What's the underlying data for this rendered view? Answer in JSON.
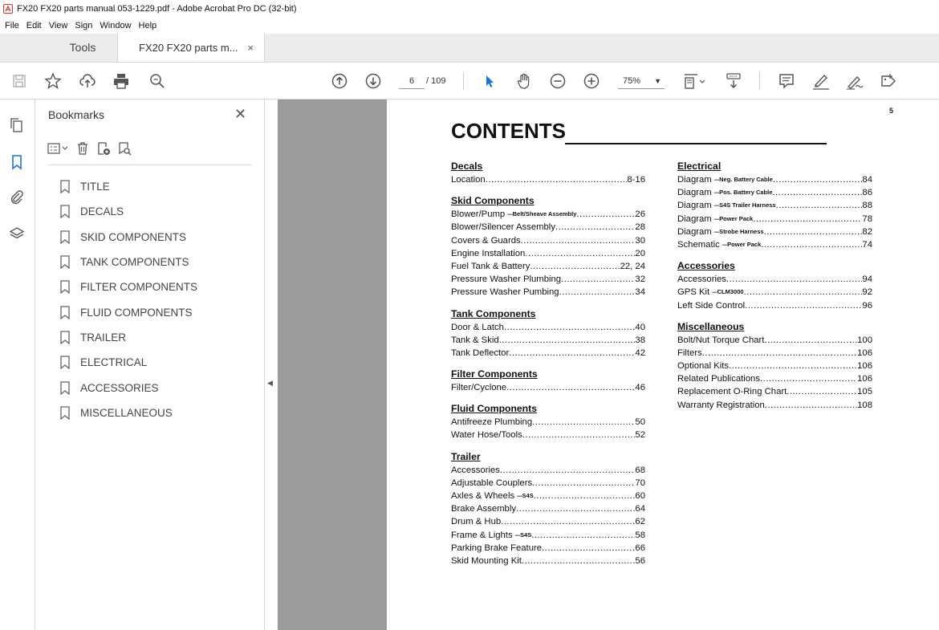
{
  "window": {
    "title": "FX20 FX20 parts manual 053-1229.pdf - Adobe Acrobat Pro DC (32-bit)"
  },
  "menu": [
    "File",
    "Edit",
    "View",
    "Sign",
    "Window",
    "Help"
  ],
  "tabs": {
    "tools": "Tools",
    "document": "FX20 FX20 parts m...",
    "close": "×"
  },
  "toolbar": {
    "page_current": "6",
    "page_total": "/ 109",
    "zoom": "75%"
  },
  "sidebar": {
    "title": "Bookmarks",
    "close": "✕",
    "items": [
      "TITLE",
      "DECALS",
      "SKID COMPONENTS",
      "TANK COMPONENTS",
      "FILTER COMPONENTS",
      "FLUID COMPONENTS",
      "TRAILER",
      "ELECTRICAL",
      "ACCESSORIES",
      "MISCELLANEOUS"
    ]
  },
  "page": {
    "number": "5",
    "title": "CONTENTS",
    "columns": [
      [
        {
          "heading": "Decals",
          "entries": [
            {
              "label": "Location",
              "sub": "",
              "page": "8-16"
            }
          ]
        },
        {
          "heading": "Skid Components",
          "entries": [
            {
              "label": "Blower/Pump – ",
              "sub": "Belt/Sheave Assembly",
              "page": "26"
            },
            {
              "label": "Blower/Silencer Assembly",
              "sub": "",
              "page": "28"
            },
            {
              "label": "Covers & Guards",
              "sub": "",
              "page": "30"
            },
            {
              "label": "Engine Installation",
              "sub": "",
              "page": "20"
            },
            {
              "label": "Fuel Tank & Battery",
              "sub": "",
              "page": "22, 24"
            },
            {
              "label": "Pressure Washer Plumbing",
              "sub": "",
              "page": "32"
            },
            {
              "label": "Pressure Washer Pumbing",
              "sub": "",
              "page": "34"
            }
          ]
        },
        {
          "heading": "Tank Components",
          "entries": [
            {
              "label": "Door & Latch",
              "sub": "",
              "page": "40"
            },
            {
              "label": "Tank & Skid",
              "sub": "",
              "page": "38"
            },
            {
              "label": "Tank Deflector",
              "sub": "",
              "page": "42"
            }
          ]
        },
        {
          "heading": "Filter Components",
          "entries": [
            {
              "label": "Filter/Cyclone",
              "sub": "",
              "page": "46"
            }
          ]
        },
        {
          "heading": "Fluid Components",
          "entries": [
            {
              "label": "Antifreeze Plumbing",
              "sub": "",
              "page": "50"
            },
            {
              "label": "Water Hose/Tools",
              "sub": "",
              "page": "52"
            }
          ]
        },
        {
          "heading": "Trailer",
          "entries": [
            {
              "label": "Accessories",
              "sub": "",
              "page": "68"
            },
            {
              "label": "Adjustable Couplers",
              "sub": "",
              "page": "70"
            },
            {
              "label": "Axles & Wheels – ",
              "sub": "S4S",
              "page": "60"
            },
            {
              "label": "Brake Assembly",
              "sub": "",
              "page": "64"
            },
            {
              "label": "Drum & Hub",
              "sub": "",
              "page": "62"
            },
            {
              "label": "Frame & Lights – ",
              "sub": "S4S",
              "page": "58"
            },
            {
              "label": "Parking Brake Feature",
              "sub": "",
              "page": "66"
            },
            {
              "label": "Skid Mounting Kit",
              "sub": "",
              "page": "56"
            }
          ]
        }
      ],
      [
        {
          "heading": "Electrical",
          "entries": [
            {
              "label": "Diagram – ",
              "sub": "Neg. Battery Cable",
              "page": "84"
            },
            {
              "label": "Diagram – ",
              "sub": "Pos. Battery Cable",
              "page": "86"
            },
            {
              "label": "Diagram – ",
              "sub": "S4S Trailer Harness",
              "page": "88"
            },
            {
              "label": "Diagram – ",
              "sub": "Power Pack",
              "page": "78"
            },
            {
              "label": "Diagram – ",
              "sub": "Strobe Harness",
              "page": "82"
            },
            {
              "label": "Schematic – ",
              "sub": "Power Pack",
              "page": "74"
            }
          ]
        },
        {
          "heading": "Accessories",
          "entries": [
            {
              "label": "Accessories",
              "sub": "",
              "page": "94"
            },
            {
              "label": "GPS Kit – ",
              "sub": "CLM3000",
              "page": "92"
            },
            {
              "label": "Left Side Control",
              "sub": "",
              "page": "96"
            }
          ]
        },
        {
          "heading": "Miscellaneous",
          "entries": [
            {
              "label": "Bolt/Nut Torque Chart",
              "sub": "",
              "page": "100"
            },
            {
              "label": "Filters",
              "sub": "",
              "page": "106"
            },
            {
              "label": "Optional Kits",
              "sub": "",
              "page": "106"
            },
            {
              "label": "Related Publications",
              "sub": "",
              "page": "106"
            },
            {
              "label": "Replacement O-Ring Chart",
              "sub": "",
              "page": "105"
            },
            {
              "label": "Warranty Registration",
              "sub": "",
              "page": "108"
            }
          ]
        }
      ]
    ]
  }
}
